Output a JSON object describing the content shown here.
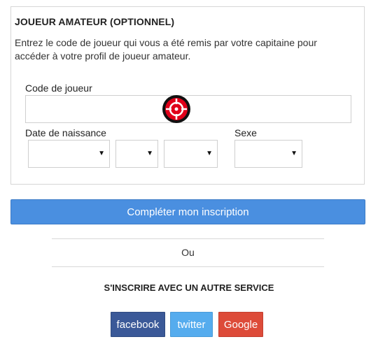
{
  "amateur": {
    "title": "JOUEUR AMATEUR (OPTIONNEL)",
    "description": "Entrez le code de joueur qui vous a été remis par votre capitaine pour accéder à votre profil de joueur amateur.",
    "player_code_label": "Code de joueur",
    "player_code_value": "",
    "birthdate_label": "Date de naissance",
    "sex_label": "Sexe"
  },
  "icons": {
    "dropdown": "caret-down-icon",
    "target": "crosshair-target-icon"
  },
  "submit_label": "Compléter mon inscription",
  "or_label": "Ou",
  "alt_service_title": "S'INSCRIRE AVEC UN AUTRE SERVICE",
  "social": {
    "facebook": "facebook",
    "twitter": "twitter",
    "google": "Google"
  },
  "colors": {
    "primary": "#4a8fe0",
    "facebook": "#3b5998",
    "twitter": "#55acee",
    "google": "#dd4b39",
    "target_red": "#e0001a"
  }
}
